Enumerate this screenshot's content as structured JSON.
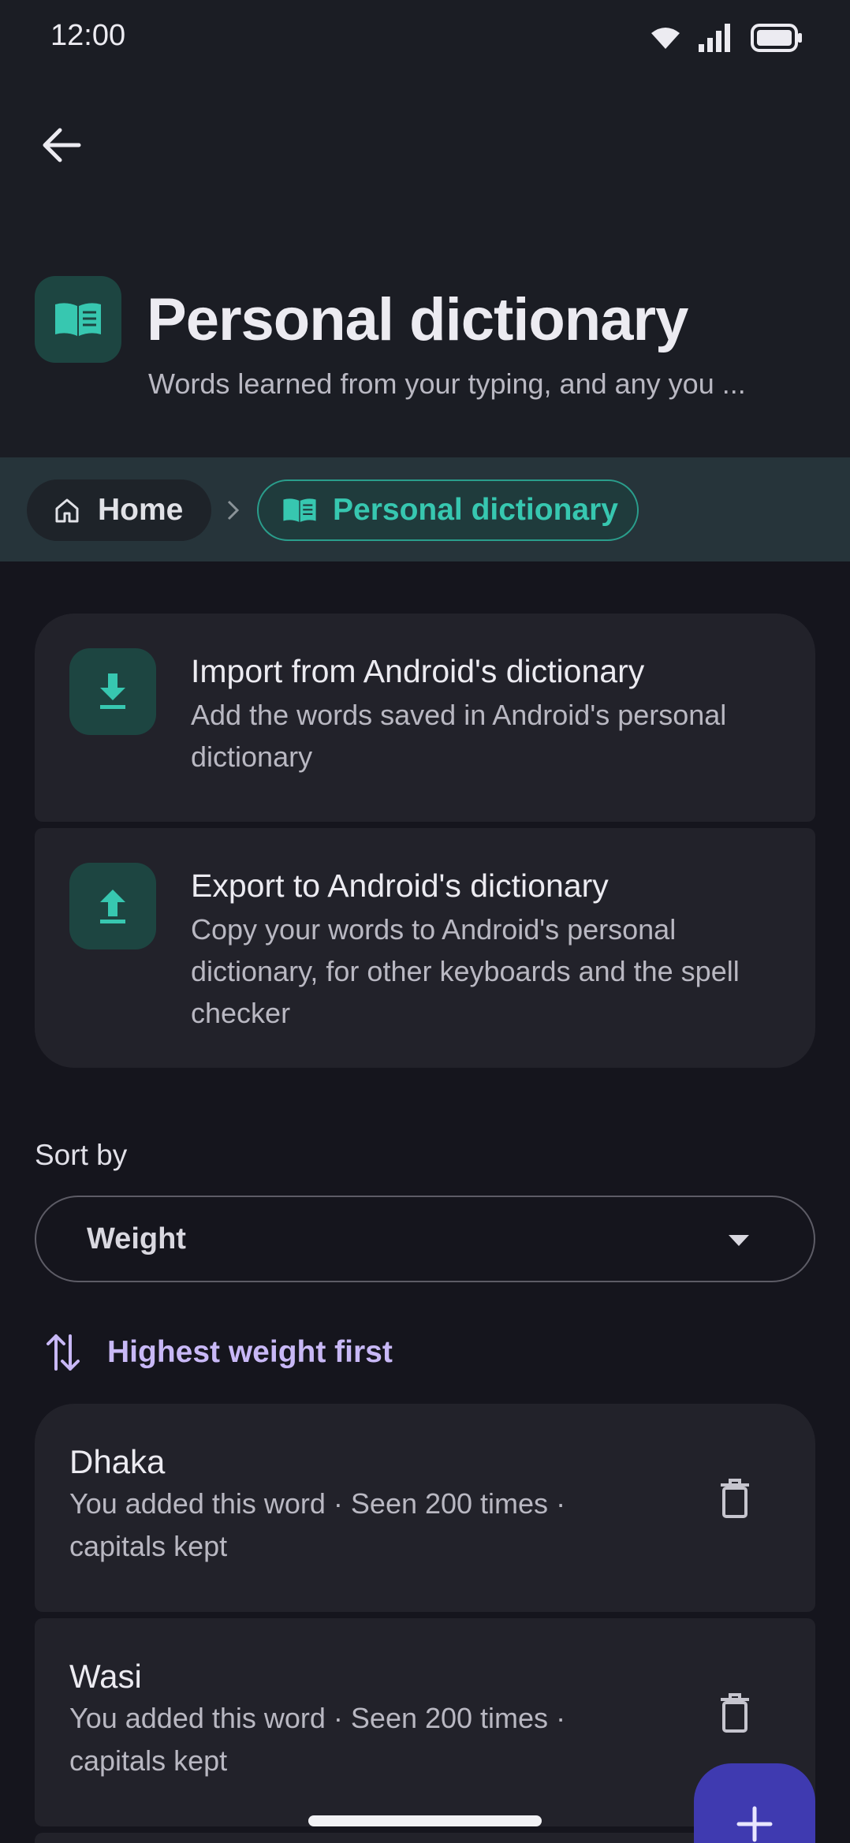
{
  "status_bar": {
    "time": "12:00"
  },
  "header": {
    "title": "Personal dictionary",
    "subtitle": "Words learned from your typing, and any you ..."
  },
  "breadcrumb": {
    "home": "Home",
    "current": "Personal dictionary"
  },
  "actions": [
    {
      "title": "Import from Android's dictionary",
      "description": "Add the words saved in Android's personal dictionary",
      "icon": "download-icon"
    },
    {
      "title": "Export to Android's dictionary",
      "description": "Copy your words to Android's personal dictionary, for other keyboards and the spell checker",
      "icon": "upload-icon"
    }
  ],
  "sort": {
    "label": "Sort by",
    "selected": "Weight",
    "order_label": "Highest weight first"
  },
  "words": [
    {
      "word": "Dhaka",
      "meta": "You added this word · Seen 200 times · capitals kept"
    },
    {
      "word": "Wasi",
      "meta": "You added this word · Seen 200 times · capitals kept"
    }
  ],
  "colors": {
    "accent_teal": "#37c7b0",
    "accent_purple": "#c8b8f6",
    "fab": "#3f3ab0"
  }
}
